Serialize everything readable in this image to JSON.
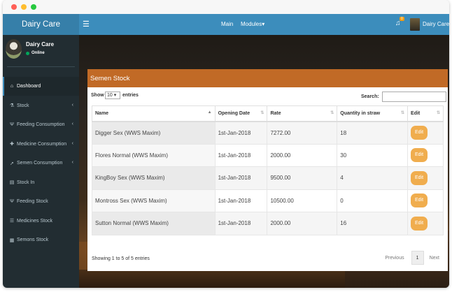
{
  "window": {
    "dots": [
      "#ff6057",
      "#ffbd2e",
      "#27c93f"
    ]
  },
  "header": {
    "logo": "Dairy Care",
    "menu_icon": "hamburger-icon",
    "nav_main": "Main",
    "nav_modules": "Modules",
    "notification_count": "0",
    "user_name": "Dairy Care",
    "color": "#3c8dbc"
  },
  "sidebar": {
    "user_name": "Dairy Care",
    "user_status": "Online",
    "items": [
      {
        "label": "Dashboard",
        "icon": "dashboard-icon",
        "glyph": "⌂",
        "active": true,
        "chevron": false
      },
      {
        "label": "Stock",
        "icon": "flask-icon",
        "glyph": "⚗",
        "active": false,
        "chevron": true
      },
      {
        "label": "Feeding Consumption",
        "icon": "cutlery-icon",
        "glyph": "Ψ",
        "active": false,
        "chevron": true
      },
      {
        "label": "Medicine Consumption",
        "icon": "medkit-icon",
        "glyph": "✚",
        "active": false,
        "chevron": true
      },
      {
        "label": "Semen Consumption",
        "icon": "rocket-icon",
        "glyph": "➚",
        "active": false,
        "chevron": true
      },
      {
        "label": "Stock In",
        "icon": "cart-icon",
        "glyph": "▤",
        "active": false,
        "chevron": false
      },
      {
        "label": "Feeding Stock",
        "icon": "cutlery-icon",
        "glyph": "Ψ",
        "active": false,
        "chevron": false
      },
      {
        "label": "Medicines Stock",
        "icon": "list-icon",
        "glyph": "☰",
        "active": false,
        "chevron": false
      },
      {
        "label": "Semons Stock",
        "icon": "table-icon",
        "glyph": "▦",
        "active": false,
        "chevron": false
      }
    ]
  },
  "panel": {
    "title": "Semen Stock",
    "header_color": "#c16a26",
    "show_label": "Show",
    "page_length": "10",
    "entries_label": "entries",
    "search_label": "Search:",
    "search_value": "",
    "columns": [
      "Name",
      "Opening Date",
      "Rate",
      "Quantity in straw",
      "Edit"
    ],
    "rows": [
      {
        "name": "Digger Sex (WWS Maxim)",
        "date": "1st-Jan-2018",
        "rate": "7272.00",
        "qty": "18",
        "edit": "Edit"
      },
      {
        "name": "Flores Normal (WWS Maxim)",
        "date": "1st-Jan-2018",
        "rate": "2000.00",
        "qty": "30",
        "edit": "Edit"
      },
      {
        "name": "KingBoy Sex (WWS Maxim)",
        "date": "1st-Jan-2018",
        "rate": "9500.00",
        "qty": "4",
        "edit": "Edit"
      },
      {
        "name": "Montross Sex (WWS Maxim)",
        "date": "1st-Jan-2018",
        "rate": "10500.00",
        "qty": "0",
        "edit": "Edit"
      },
      {
        "name": "Sutton Normal (WWS Maxim)",
        "date": "1st-Jan-2018",
        "rate": "2000.00",
        "qty": "16",
        "edit": "Edit"
      }
    ],
    "info": "Showing 1 to 5 of 5 entries",
    "pagination": {
      "previous": "Previous",
      "current": "1",
      "next": "Next"
    },
    "edit_color": "#f0ad4e"
  }
}
